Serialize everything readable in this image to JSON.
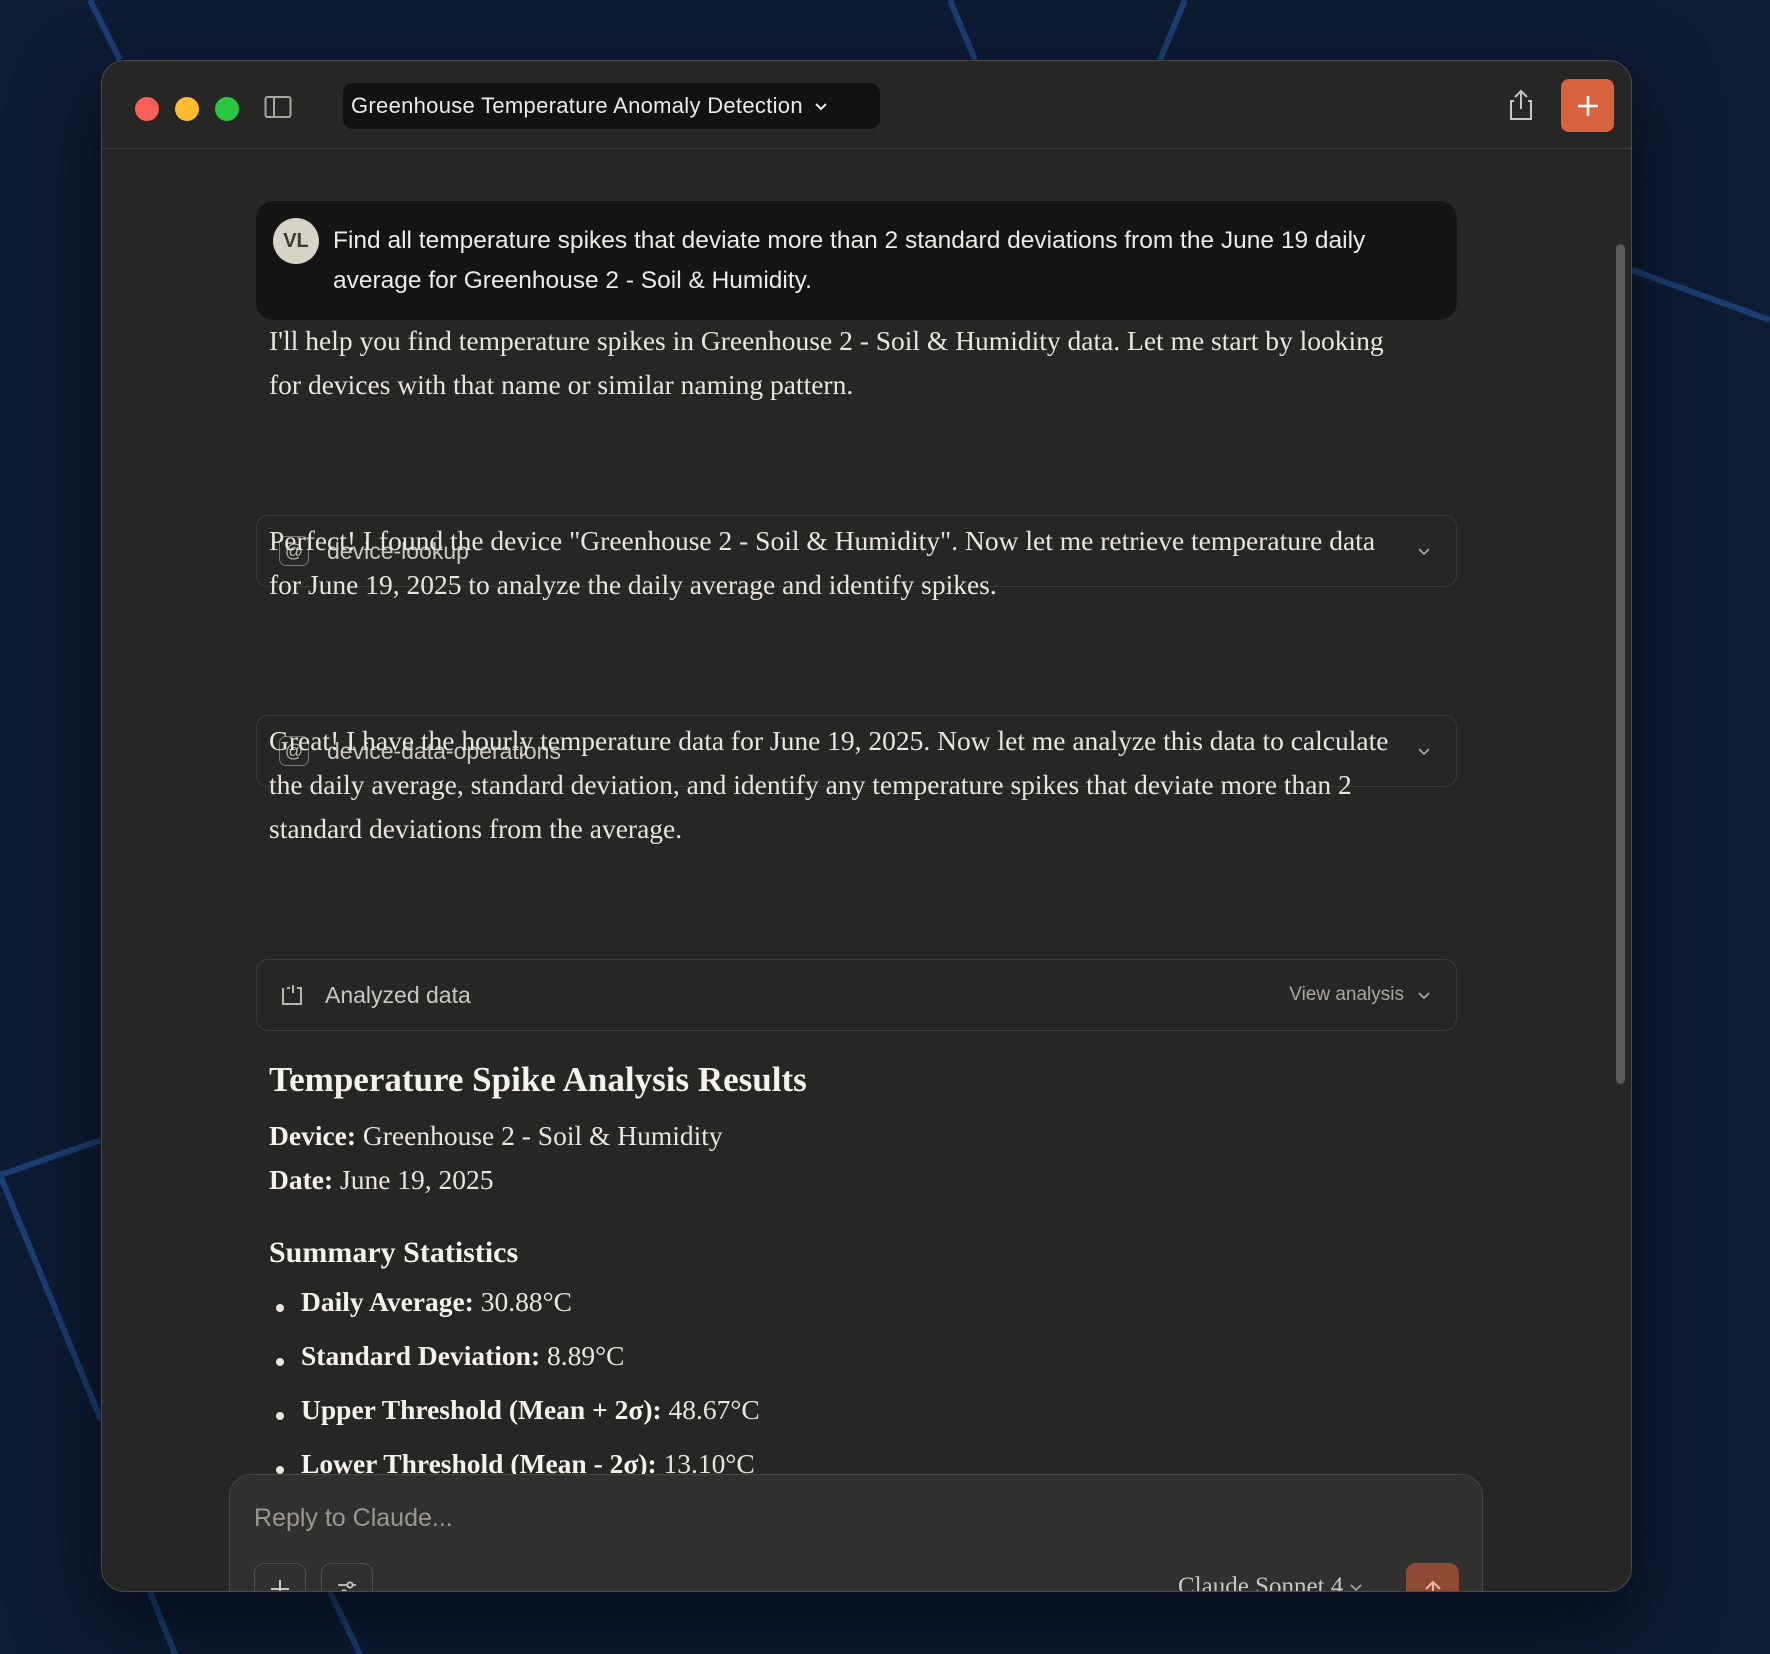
{
  "window": {
    "title": "Greenhouse Temperature Anomaly Detection"
  },
  "conversation": {
    "user": {
      "initials": "VL",
      "message": "Find all temperature spikes that deviate more than 2 standard deviations from the June 19 daily average for Greenhouse 2 - Soil & Humidity."
    },
    "assistant_intro": "I'll help you find temperature spikes in Greenhouse 2 - Soil & Humidity data. Let me start by looking for devices with that name or similar naming pattern.",
    "tool_1": {
      "name": "device-lookup"
    },
    "assistant_found": "Perfect! I found the device \"Greenhouse 2 - Soil & Humidity\". Now let me retrieve temperature data for June 19, 2025 to analyze the daily average and identify spikes.",
    "tool_2": {
      "name": "device-data-operations"
    },
    "assistant_analyze": "Great! I have the hourly temperature data for June 19, 2025. Now let me analyze this data to calculate the daily average, standard deviation, and identify any temperature spikes that deviate more than 2 standard deviations from the average.",
    "analysis_box": {
      "label": "Analyzed data",
      "view_label": "View analysis"
    }
  },
  "results": {
    "heading": "Temperature Spike Analysis Results",
    "device_label": "Device:",
    "device_value": "Greenhouse 2 - Soil & Humidity",
    "date_label": "Date:",
    "date_value": "June 19, 2025",
    "summary_heading": "Summary Statistics",
    "stats": [
      {
        "label": "Daily Average:",
        "value": "30.88°C"
      },
      {
        "label": "Standard Deviation:",
        "value": "8.89°C"
      },
      {
        "label": "Upper Threshold (Mean + 2σ):",
        "value": "48.67°C"
      },
      {
        "label": "Lower Threshold (Mean - 2σ):",
        "value": "13.10°C"
      }
    ]
  },
  "composer": {
    "placeholder": "Reply to Claude...",
    "model": "Claude Sonnet 4"
  },
  "colors": {
    "accent": "#d9633f",
    "send_button": "#8f4a33",
    "window_bg": "#262624",
    "desktop_bg": "#0d1b33"
  },
  "icons": {
    "sidebar_toggle": "sidebar-icon",
    "share": "share-icon",
    "new_chat": "plus-icon",
    "tool": "at-icon",
    "analysis": "analysis-icon",
    "attach": "plus-icon",
    "settings": "sliders-icon",
    "send": "arrow-up-icon"
  }
}
